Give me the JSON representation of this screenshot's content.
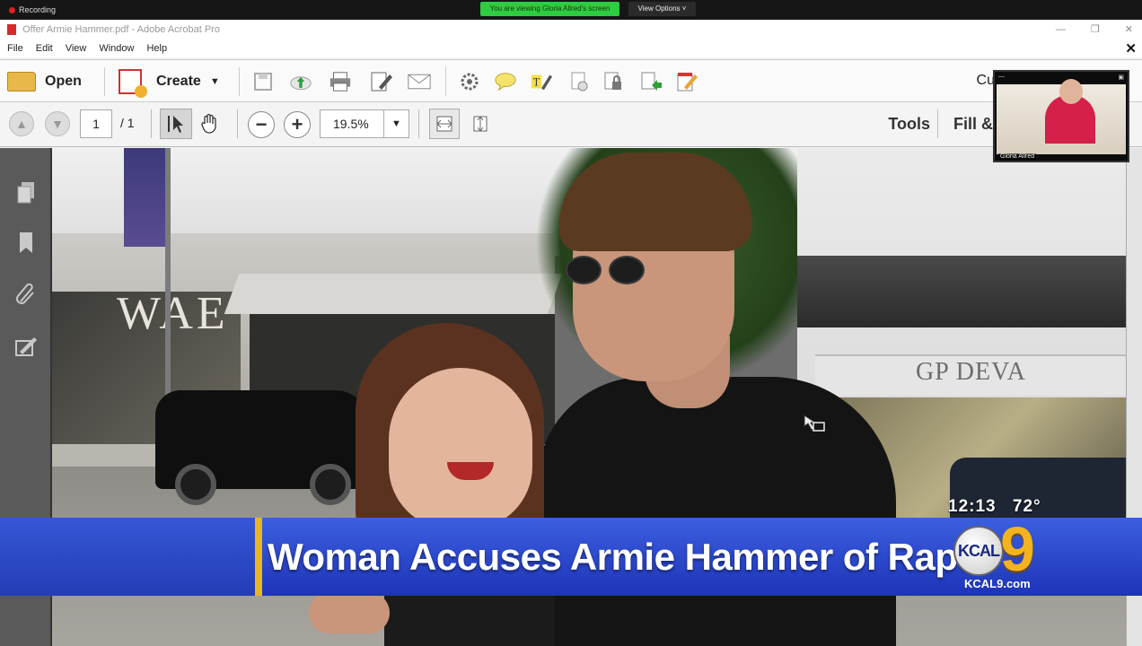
{
  "zoom_bar": {
    "recording_label": "Recording",
    "share_banner": "You are viewing Gloria Allred's screen",
    "view_options": "View Options ˅"
  },
  "acrobat": {
    "title": "Offer Armie Hammer.pdf - Adobe Acrobat Pro",
    "window_controls": [
      "—",
      "❐",
      "✕"
    ],
    "menu": [
      "File",
      "Edit",
      "View",
      "Window",
      "Help"
    ],
    "close_label": "✕",
    "toolbar": {
      "open_label": "Open",
      "create_label": "Create",
      "customize_partial": "Cu"
    },
    "nav": {
      "page_current": "1",
      "page_total": "/ 1",
      "zoom_value": "19.5%",
      "tools_label": "Tools",
      "fill_sign_partial": "Fill &"
    }
  },
  "photo_text": {
    "store_sign": "WAE",
    "building_sign": "GP DEVA"
  },
  "participant": {
    "name": "Gloria Allred"
  },
  "broadcast": {
    "headline": "Woman Accuses Armie Hammer of Rape",
    "time": "12:13",
    "temperature": "72°",
    "station_disc": "KCAL",
    "station_number": "9",
    "station_url": "KCAL9.com",
    "colors": {
      "chyron_blue": "#2a47cc",
      "accent_gold": "#e7b624"
    }
  }
}
